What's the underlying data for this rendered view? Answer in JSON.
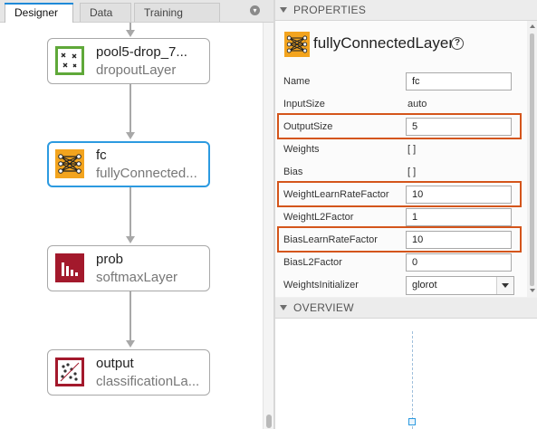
{
  "tabs": [
    {
      "label": "Designer"
    },
    {
      "label": "Data"
    },
    {
      "label": "Training"
    }
  ],
  "nodes": [
    {
      "name": "pool5-drop_7...",
      "type": "dropoutLayer",
      "icon": "dropout-icon",
      "color": "#5fa839"
    },
    {
      "name": "fc",
      "type": "fullyConnected...",
      "icon": "fully-connected-icon",
      "color": "#f3a41e",
      "selected": true
    },
    {
      "name": "prob",
      "type": "softmaxLayer",
      "icon": "softmax-icon",
      "color": "#a3192c"
    },
    {
      "name": "output",
      "type": "classificationLa...",
      "icon": "classification-icon",
      "color": "#a3192c"
    }
  ],
  "properties": {
    "header": "PROPERTIES",
    "layer_title": "fullyConnectedLayer",
    "help_label": "?",
    "fields": [
      {
        "label": "Name",
        "value": "fc",
        "editable": true
      },
      {
        "label": "InputSize",
        "value": "auto",
        "editable": false
      },
      {
        "label": "OutputSize",
        "value": "5",
        "editable": true,
        "highlighted": true
      },
      {
        "label": "Weights",
        "value": "[ ]",
        "editable": false
      },
      {
        "label": "Bias",
        "value": "[ ]",
        "editable": false
      },
      {
        "label": "WeightLearnRateFactor",
        "value": "10",
        "editable": true,
        "highlighted": true
      },
      {
        "label": "WeightL2Factor",
        "value": "1",
        "editable": true
      },
      {
        "label": "BiasLearnRateFactor",
        "value": "10",
        "editable": true,
        "highlighted": true
      },
      {
        "label": "BiasL2Factor",
        "value": "0",
        "editable": true
      },
      {
        "label": "WeightsInitializer",
        "value": "glorot",
        "editable": true,
        "type": "dropdown"
      }
    ]
  },
  "overview": {
    "header": "OVERVIEW"
  },
  "colors": {
    "selection": "#2c9ae0",
    "highlight": "#d4551b",
    "dropout": "#5fa839",
    "fully_connected": "#f3a41e",
    "output_layers": "#a3192c"
  }
}
